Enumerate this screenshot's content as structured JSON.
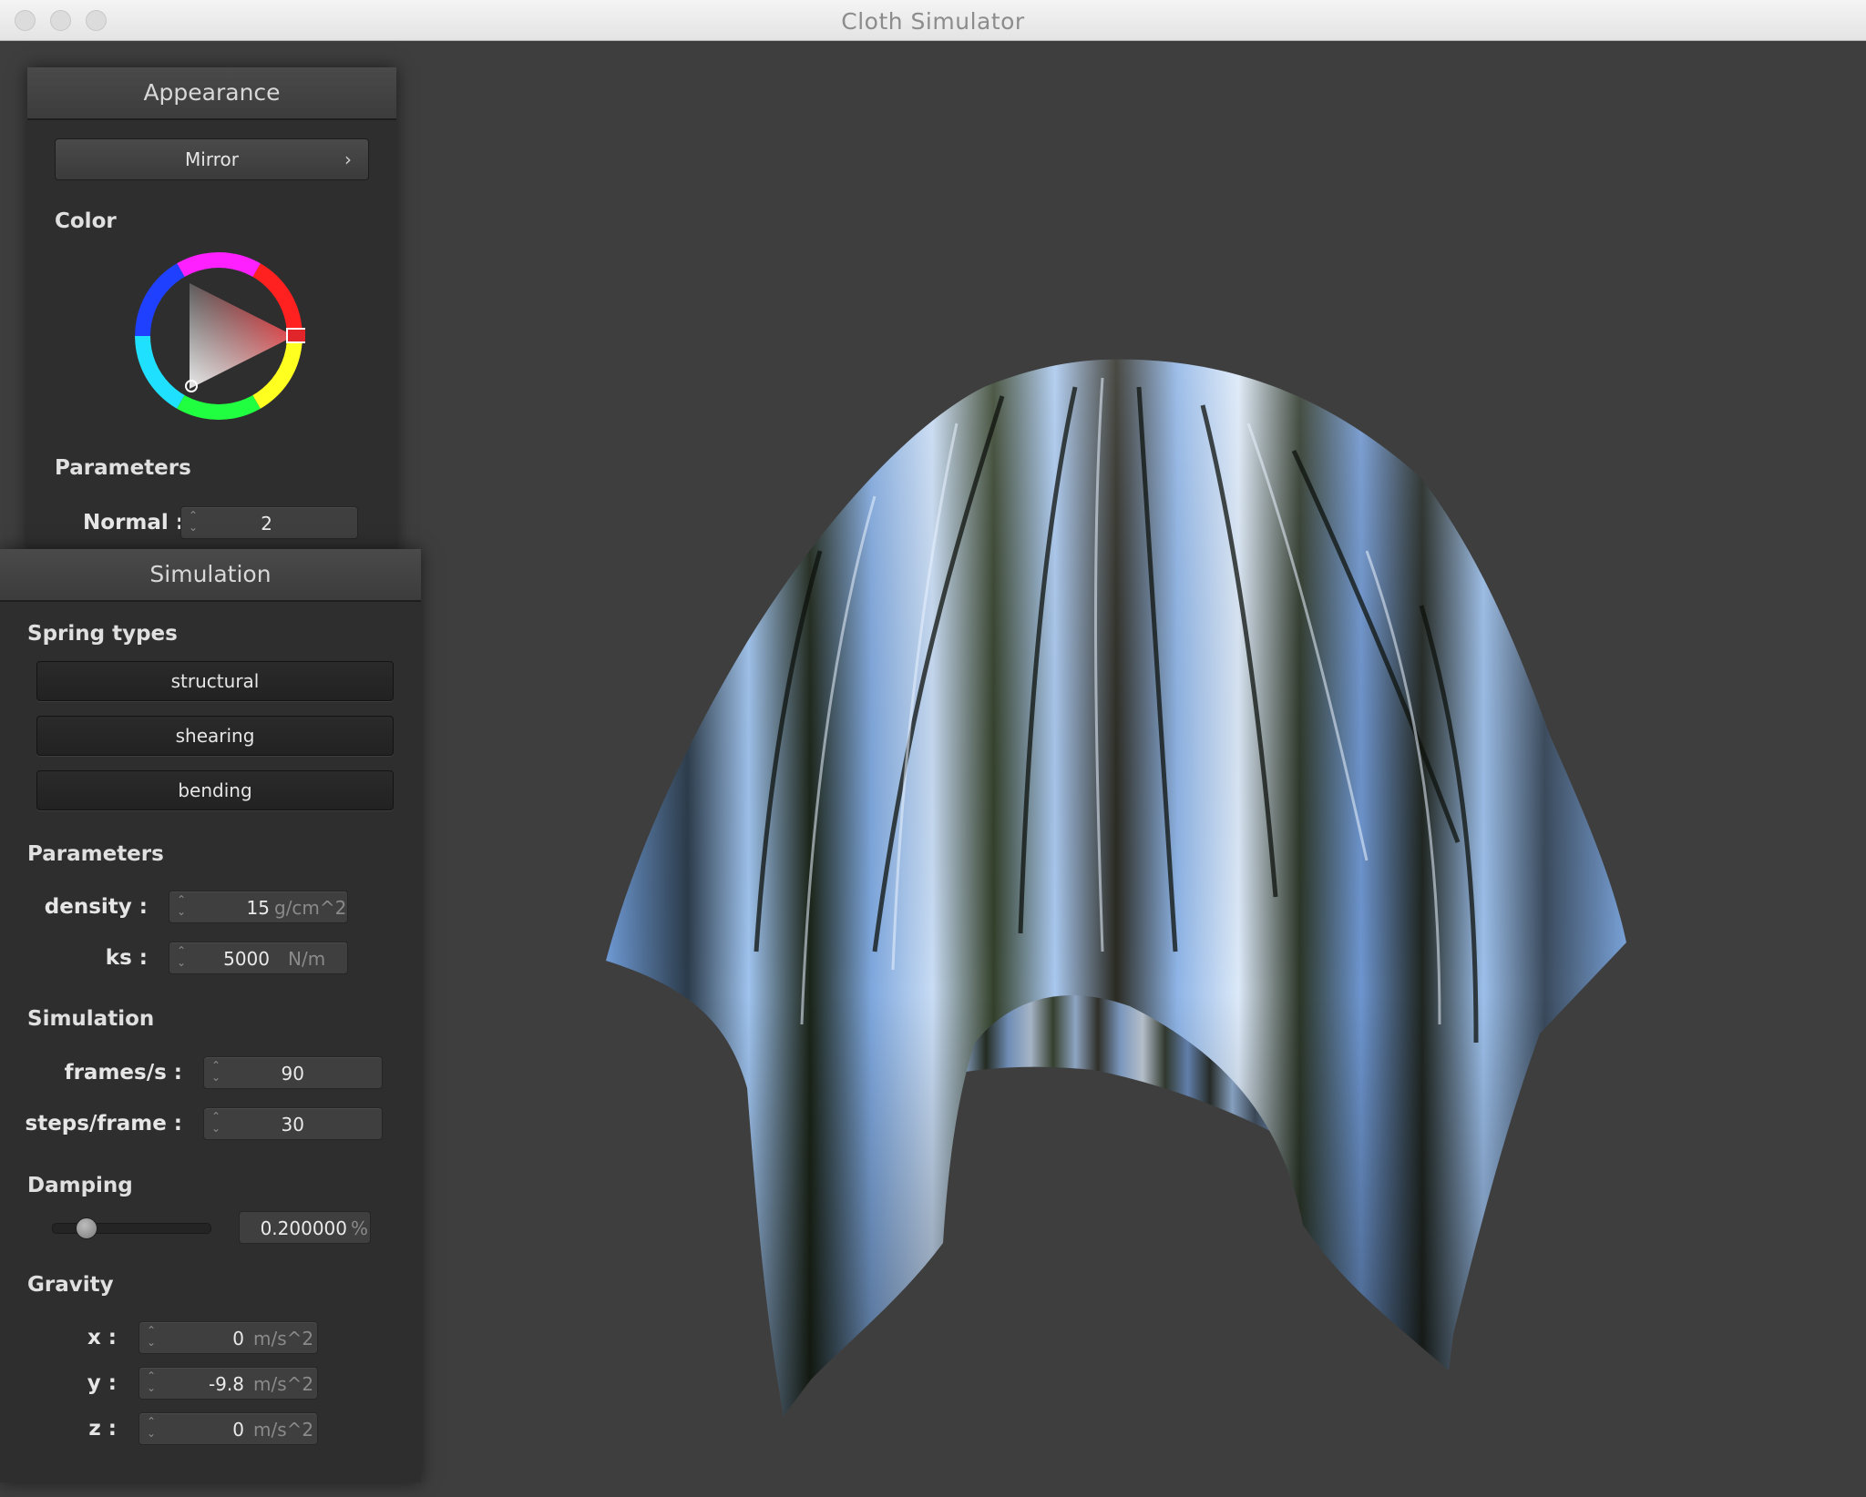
{
  "window": {
    "title": "Cloth Simulator"
  },
  "appearance": {
    "header": "Appearance",
    "shader_dropdown": "Mirror",
    "color_label": "Color",
    "color_value": "#e0262b",
    "parameters_label": "Parameters",
    "normal_label": "Normal :",
    "normal_value": "2"
  },
  "simulation": {
    "header": "Simulation",
    "spring_types_label": "Spring types",
    "spring_buttons": [
      "structural",
      "shearing",
      "bending"
    ],
    "parameters_label": "Parameters",
    "density_label": "density :",
    "density_value": "15",
    "density_unit": "g/cm^2",
    "ks_label": "ks :",
    "ks_value": "5000",
    "ks_unit": "N/m",
    "sim_label": "Simulation",
    "fps_label": "frames/s :",
    "fps_value": "90",
    "steps_label": "steps/frame :",
    "steps_value": "30",
    "damping_label": "Damping",
    "damping_value": "0.200000",
    "damping_unit": "%",
    "damping_slider_fraction": 0.2,
    "gravity_label": "Gravity",
    "gravity_x_label": "x :",
    "gravity_x_value": "0",
    "gravity_y_label": "y :",
    "gravity_y_value": "-9.8",
    "gravity_z_label": "z :",
    "gravity_z_value": "0",
    "gravity_unit": "m/s^2"
  },
  "icons": {
    "close": "window-close-icon",
    "minimize": "window-minimize-icon",
    "zoom": "window-zoom-icon",
    "dropdown": "chevron-right-icon",
    "spinner": "spinner-arrows-icon"
  }
}
